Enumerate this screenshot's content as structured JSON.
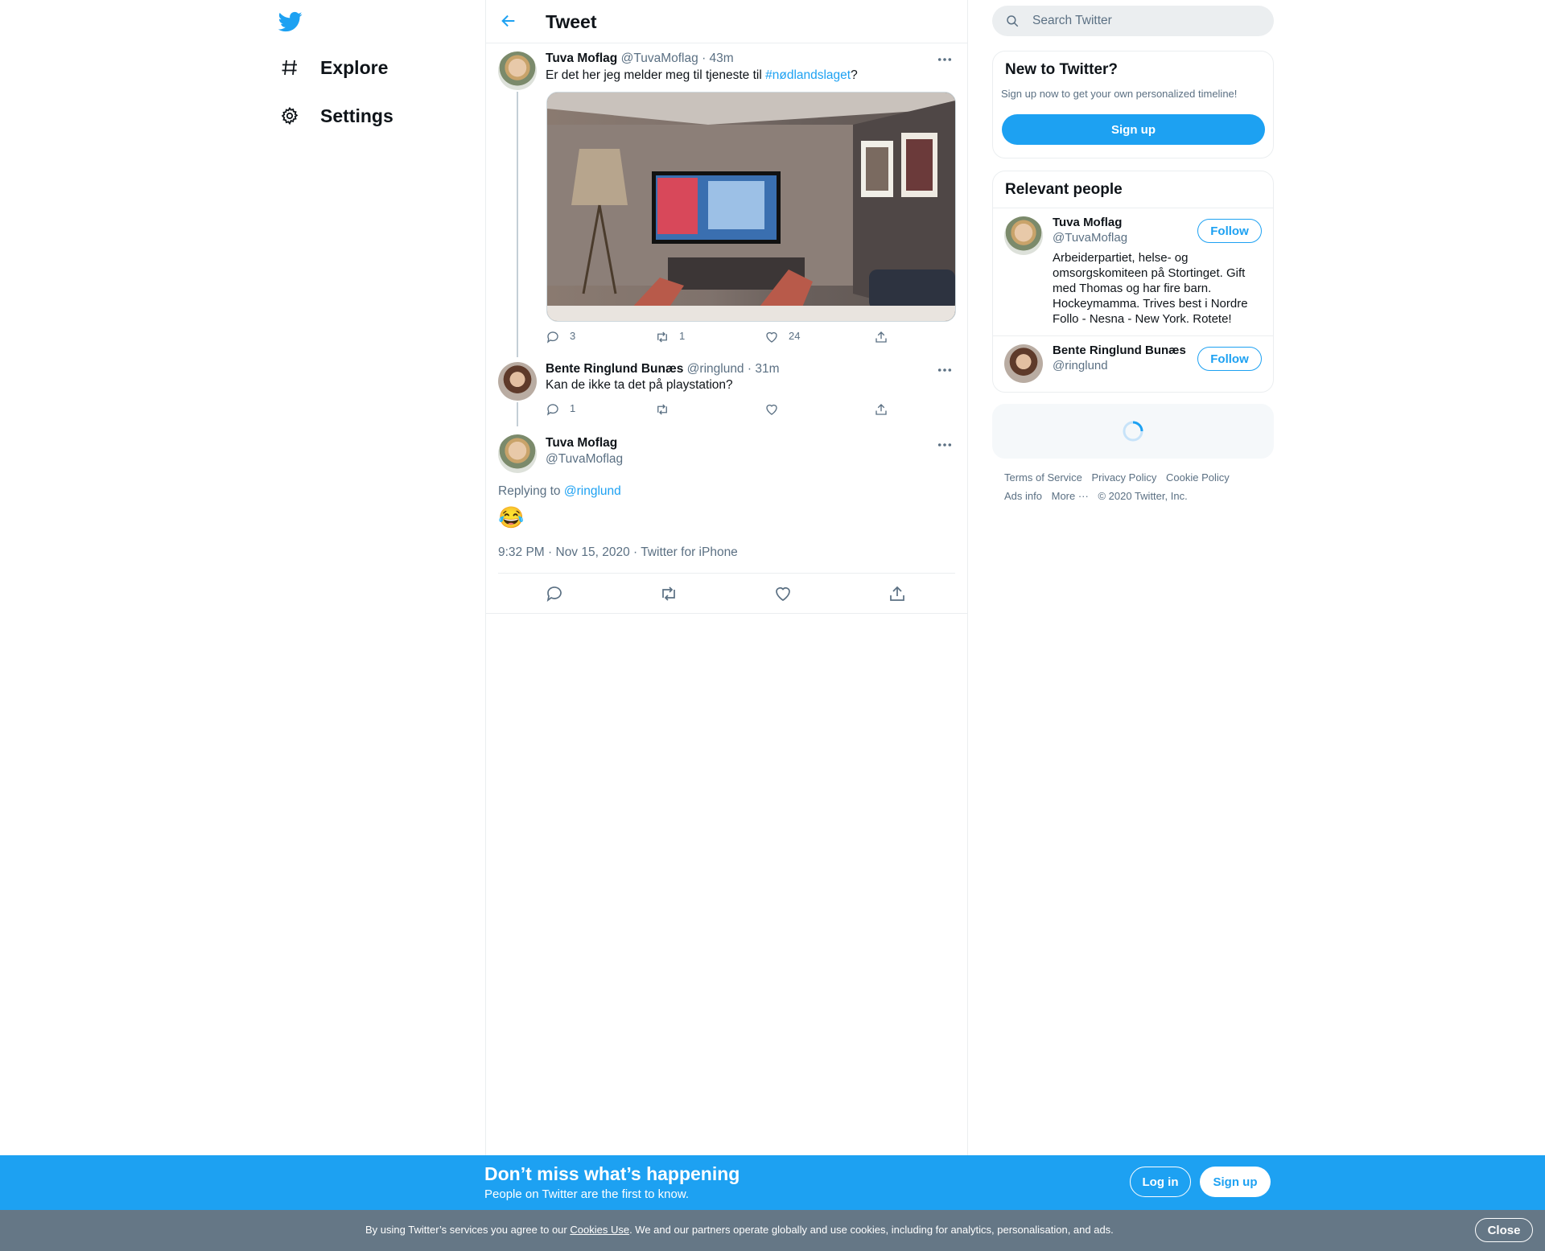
{
  "nav": {
    "logo_icon": "twitter-bird-icon",
    "items": [
      {
        "label": "Explore",
        "icon": "hashtag-icon"
      },
      {
        "label": "Settings",
        "icon": "gear-icon"
      }
    ]
  },
  "header": {
    "title": "Tweet",
    "back_icon": "back-arrow-icon"
  },
  "thread": [
    {
      "name": "Tuva Moflag",
      "handle": "@TuvaMoflag",
      "time": "· 43m",
      "text_before": "Er det her jeg melder meg til tjeneste til ",
      "hashtag": "#nødlandslaget",
      "text_after": "?",
      "replies": "3",
      "retweets": "1",
      "likes": "24"
    },
    {
      "name": "Bente Ringlund Bunæs",
      "handle": "@ringlund",
      "time": "· 31m",
      "text": "Kan de ikke ta det på playstation?",
      "replies": "1",
      "retweets": "",
      "likes": ""
    }
  ],
  "main_tweet": {
    "name": "Tuva Moflag",
    "handle": "@TuvaMoflag",
    "replying_prefix": "Replying to ",
    "replying_handle": "@ringlund",
    "emoji": "😂",
    "timestamp": "9:32 PM · Nov 15, 2020 · Twitter for iPhone"
  },
  "search": {
    "placeholder": "Search Twitter"
  },
  "new_to_twitter": {
    "title": "New to Twitter?",
    "subtitle": "Sign up now to get your own personalized timeline!",
    "button": "Sign up"
  },
  "relevant_people": {
    "title": "Relevant people",
    "people": [
      {
        "name": "Tuva Moflag",
        "handle": "@TuvaMoflag",
        "bio": "Arbeiderpartiet, helse- og omsorgskomiteen på Stortinget. Gift med Thomas og har fire barn. Hockeymamma. Trives best i Nordre Follo - Nesna - New York. Rotete!",
        "follow": "Follow"
      },
      {
        "name": "Bente Ringlund Bunæs",
        "handle": "@ringlund",
        "bio": "",
        "follow": "Follow"
      }
    ]
  },
  "footer": {
    "row1": [
      "Terms of Service",
      "Privacy Policy",
      "Cookie Policy"
    ],
    "row2": [
      "Ads info",
      "More ···",
      "© 2020 Twitter, Inc."
    ]
  },
  "banner": {
    "title": "Don’t miss what’s happening",
    "subtitle": "People on Twitter are the first to know.",
    "login": "Log in",
    "signup": "Sign up"
  },
  "cookies": {
    "before": "By using Twitter’s services you agree to our ",
    "link": "Cookies Use",
    "after": ". We and our partners operate globally and use cookies, including for analytics, personalisation, and ads.",
    "close": "Close"
  },
  "colors": {
    "accent": "#1da1f2",
    "text": "#0f1419",
    "muted": "#5b7083",
    "cookie_bar": "#657786"
  }
}
